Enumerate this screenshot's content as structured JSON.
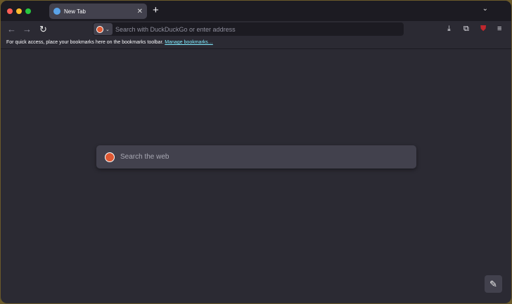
{
  "tab": {
    "title": "New Tab"
  },
  "url_bar": {
    "placeholder": "Search with DuckDuckGo or enter address"
  },
  "bookmarks": {
    "message": "For quick access, place your bookmarks here on the bookmarks toolbar.",
    "link": "Manage bookmarks…"
  },
  "page": {
    "search_placeholder": "Search the web"
  }
}
